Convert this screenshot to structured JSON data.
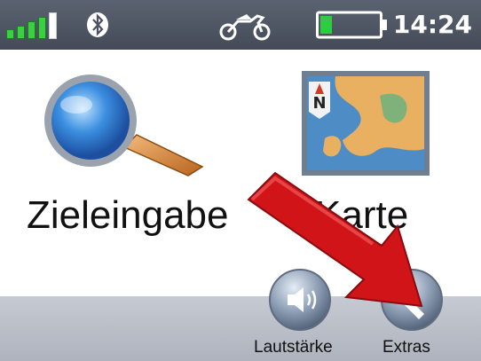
{
  "status": {
    "signal_bars": 4,
    "signal_total": 5,
    "bluetooth_icon": "bluetooth-icon",
    "mode_icon": "motorcycle-icon",
    "battery_level": 0.2,
    "time": "14:24"
  },
  "main": {
    "tiles": [
      {
        "label": "Zieleingabe",
        "icon": "magnifier-icon"
      },
      {
        "label": "Karte",
        "icon": "map-icon"
      }
    ]
  },
  "bottom": {
    "buttons": [
      {
        "label": "Lautstärke",
        "icon": "speaker-icon"
      },
      {
        "label": "Extras",
        "icon": "wrench-icon"
      }
    ]
  },
  "overlay": {
    "arrow_icon": "red-arrow-icon",
    "arrow_color": "#d01418"
  },
  "colors": {
    "status_bar": "#4b525e",
    "signal": "#39d13f",
    "battery": "#2ecc40",
    "bottom_bar": "#b8bcc6"
  }
}
